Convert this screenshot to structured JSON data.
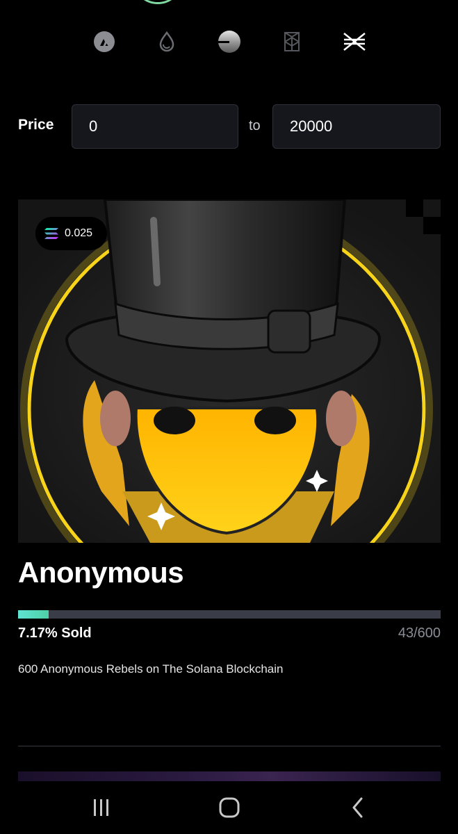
{
  "chains": [
    {
      "name": "avalanche-icon"
    },
    {
      "name": "sui-icon"
    },
    {
      "name": "sphere-icon"
    },
    {
      "name": "fantom-icon"
    },
    {
      "name": "stellar-icon"
    }
  ],
  "filter": {
    "price_label": "Price",
    "min_value": "0",
    "to_label": "to",
    "max_value": "20000"
  },
  "nft": {
    "price": "0.025",
    "currency_icon": "solana-icon",
    "title": "Anonymous",
    "sold_percent": 7.17,
    "sold_label": "7.17% Sold",
    "count": "43/600",
    "description": "600 Anonymous Rebels on The Solana Blockchain"
  },
  "colors": {
    "progress": "#5fe3d3",
    "track": "#3a3c48",
    "ring": "#f7d31a"
  },
  "android_nav": {
    "recents": "recents-icon",
    "home": "home-icon",
    "back": "back-icon"
  }
}
